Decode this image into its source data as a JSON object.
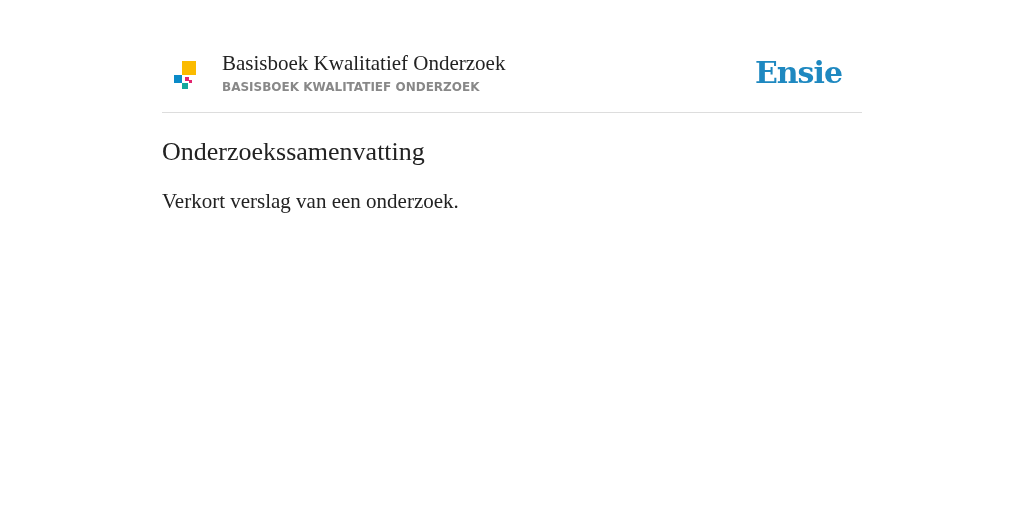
{
  "header": {
    "title": "Basisboek Kwalitatief Onderzoek",
    "subtitle": "BASISBOEK KWALITATIEF ONDERZOEK",
    "brand": "Ensie"
  },
  "entry": {
    "term": "Onderzoekssamenvatting",
    "definition": "Verkort verslag van een onderzoek."
  }
}
